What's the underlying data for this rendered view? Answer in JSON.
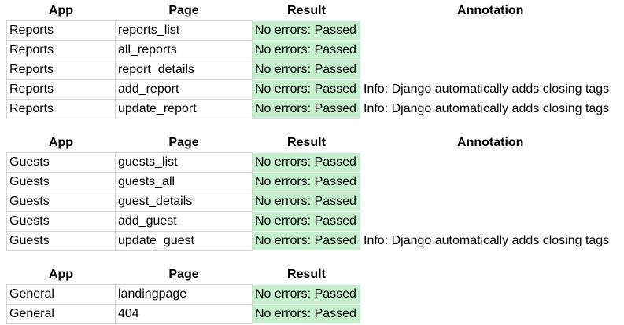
{
  "sections": [
    {
      "headers": {
        "app": "App",
        "page": "Page",
        "result": "Result",
        "annotation": "Annotation"
      },
      "rows": [
        {
          "app": "Reports",
          "page": "reports_list",
          "result": "No errors: Passed",
          "annotation": ""
        },
        {
          "app": "Reports",
          "page": "all_reports",
          "result": "No errors: Passed",
          "annotation": ""
        },
        {
          "app": "Reports",
          "page": "report_details",
          "result": "No errors: Passed",
          "annotation": ""
        },
        {
          "app": "Reports",
          "page": "add_report",
          "result": "No errors: Passed",
          "annotation": "Info: Django automatically adds closing tags"
        },
        {
          "app": "Reports",
          "page": "update_report",
          "result": "No errors: Passed",
          "annotation": "Info: Django automatically adds closing tags"
        }
      ]
    },
    {
      "headers": {
        "app": "App",
        "page": "Page",
        "result": "Result",
        "annotation": "Annotation"
      },
      "rows": [
        {
          "app": "Guests",
          "page": "guests_list",
          "result": "No errors: Passed",
          "annotation": ""
        },
        {
          "app": "Guests",
          "page": "guests_all",
          "result": "No errors: Passed",
          "annotation": ""
        },
        {
          "app": "Guests",
          "page": "guest_details",
          "result": "No errors: Passed",
          "annotation": ""
        },
        {
          "app": "Guests",
          "page": "add_guest",
          "result": "No errors: Passed",
          "annotation": ""
        },
        {
          "app": "Guests",
          "page": "update_guest",
          "result": "No errors: Passed",
          "annotation": "Info: Django automatically adds closing tags"
        }
      ]
    },
    {
      "headers": {
        "app": "App",
        "page": "Page",
        "result": "Result",
        "annotation": ""
      },
      "rows": [
        {
          "app": "General",
          "page": "landingpage",
          "result": "No errors: Passed",
          "annotation": ""
        },
        {
          "app": "General",
          "page": "404",
          "result": "No errors: Passed",
          "annotation": ""
        }
      ]
    }
  ],
  "colors": {
    "passed_fill": "#c6efce",
    "grid_line": "#d4d4d4"
  }
}
